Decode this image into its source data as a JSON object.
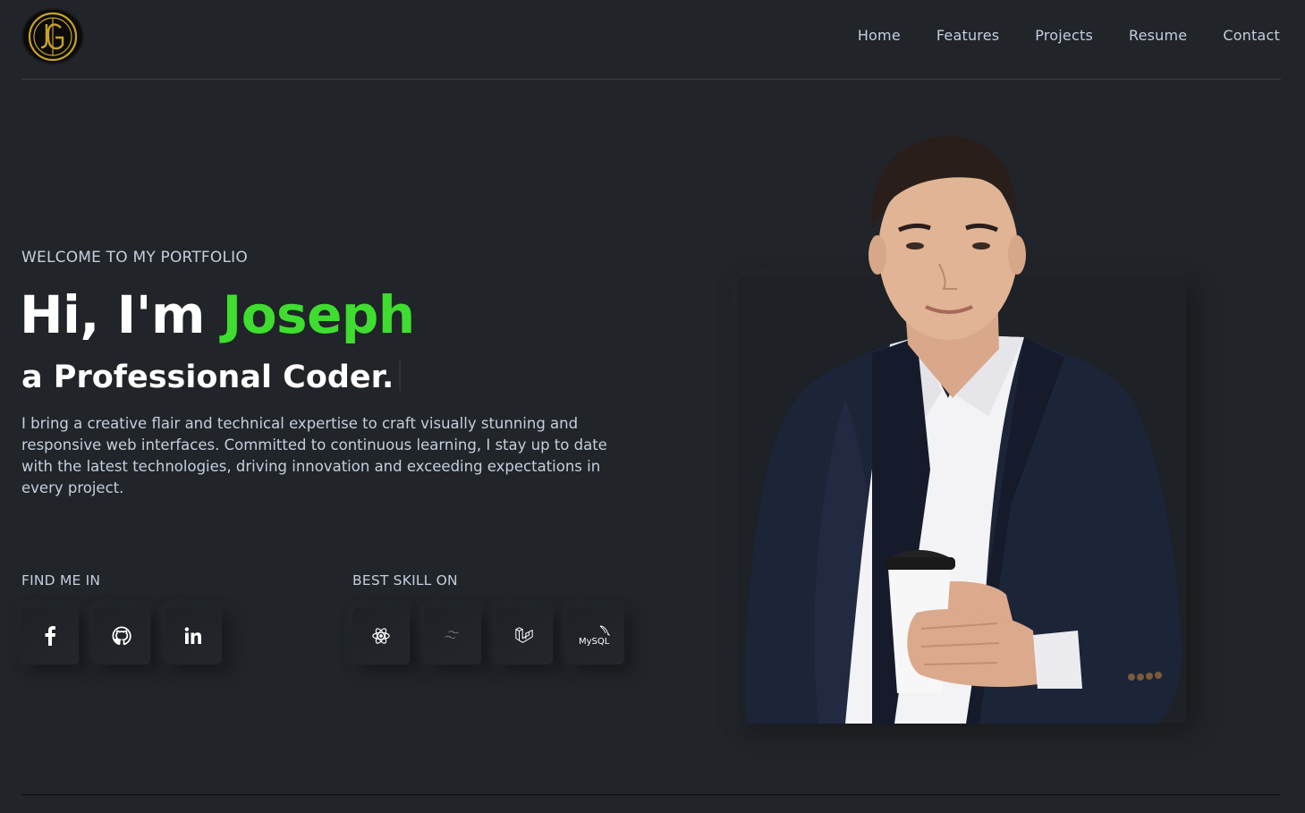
{
  "nav": {
    "items": [
      "Home",
      "Features",
      "Projects",
      "Resume",
      "Contact"
    ]
  },
  "logo": {
    "icon": "jg-monogram-logo",
    "color": "#c9a227"
  },
  "hero": {
    "welcome": "WELCOME TO MY PORTFOLIO",
    "greeting": "Hi, I'm ",
    "name": "Joseph",
    "role": "a Professional Coder.",
    "description": "I bring a creative flair and technical expertise to craft visually stunning and responsive web interfaces. Committed to continuous learning, I stay up to date with the latest technologies, driving innovation and exceeding expectations in every project.",
    "accent_color": "#3fdd2f"
  },
  "social": {
    "label": "FIND ME IN",
    "icons": [
      "facebook-icon",
      "github-icon",
      "linkedin-icon"
    ]
  },
  "skills": {
    "label": "BEST SKILL ON",
    "icons": [
      "react-icon",
      "tailwind-icon",
      "laravel-icon",
      "mysql-icon"
    ],
    "mysql_text": "MySQL"
  },
  "photo": {
    "icon": "portrait-photo"
  }
}
